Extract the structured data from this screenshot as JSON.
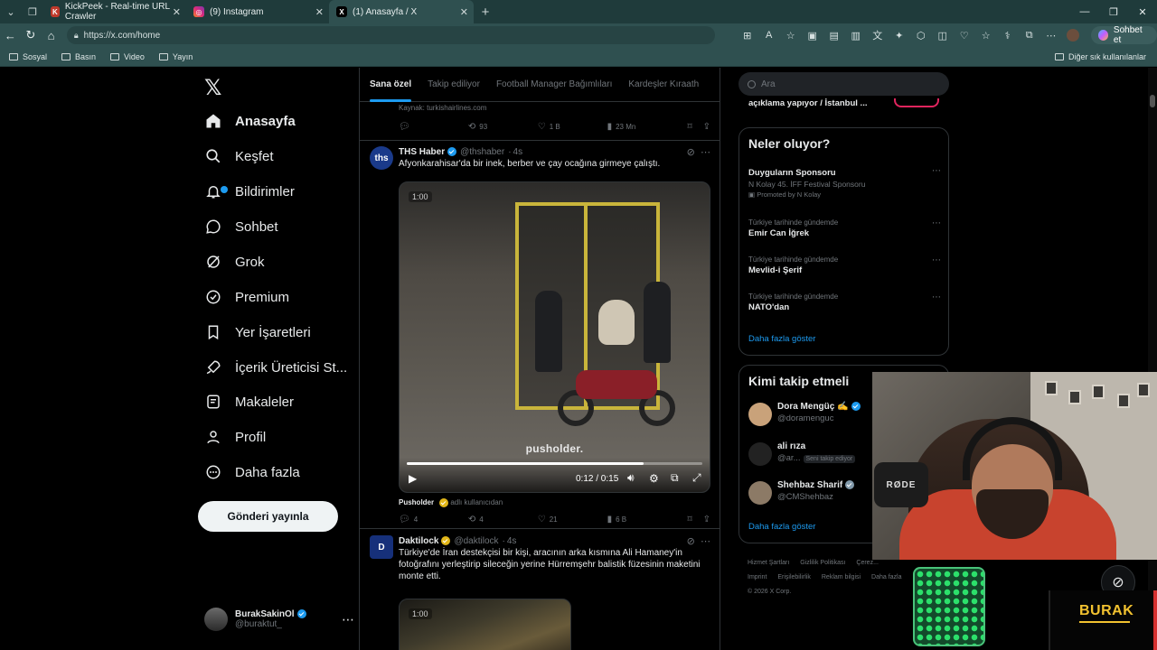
{
  "browser": {
    "tabs": [
      {
        "title": "KickPeek - Real-time URL Crawler",
        "icon": "kickpeek-icon",
        "active": false
      },
      {
        "title": "(9) Instagram",
        "icon": "instagram-icon",
        "active": false
      },
      {
        "title": "(1) Anasayfa / X",
        "icon": "x-icon",
        "active": true
      }
    ],
    "url": "https://x.com/home",
    "copilot_label": "Sohbet et",
    "bookmarks": [
      "Sosyal",
      "Basın",
      "Video",
      "Yayın"
    ],
    "bookmarks_other": "Diğer sık kullanılanlar"
  },
  "nav": {
    "items": [
      {
        "label": "Anasayfa",
        "icon": "home-icon"
      },
      {
        "label": "Keşfet",
        "icon": "search-icon"
      },
      {
        "label": "Bildirimler",
        "icon": "bell-icon"
      },
      {
        "label": "Sohbet",
        "icon": "chat-icon"
      },
      {
        "label": "Grok",
        "icon": "grok-icon"
      },
      {
        "label": "Premium",
        "icon": "premium-icon"
      },
      {
        "label": "Yer İşaretleri",
        "icon": "bookmark-icon"
      },
      {
        "label": "İçerik Üreticisi St...",
        "icon": "rocket-icon"
      },
      {
        "label": "Makaleler",
        "icon": "article-icon"
      },
      {
        "label": "Profil",
        "icon": "profile-icon"
      },
      {
        "label": "Daha fazla",
        "icon": "more-circle-icon"
      }
    ],
    "post_button": "Gönderi yayınla",
    "account": {
      "name": "BurakSakinOl",
      "handle": "@buraktut_"
    }
  },
  "timeline": {
    "tabs": [
      "Sana özel",
      "Takip ediliyor",
      "Football Manager Bağımlıları",
      "Kardeşler Kıraath"
    ],
    "prev_tail": {
      "source": "Kaynak: turkishairlines.com",
      "retweets": "93",
      "likes": "1 B",
      "views": "23 Mn"
    },
    "tweets": [
      {
        "name": "THS Haber",
        "handle": "@thshaber",
        "time": "4s",
        "avatar_text": "ths",
        "text": "Afyonkarahisar'da bir inek, berber ve çay ocağına girmeye çalıştı.",
        "video": {
          "time_chip": "1:00",
          "watermark": "pusholder.",
          "time": "0:12 / 0:15",
          "progress": 0.8
        },
        "attribution_name": "Pusholder",
        "attribution_suffix": "adlı kullanıcıdan",
        "replies": "4",
        "retweets": "4",
        "likes": "21",
        "views": "6 B"
      },
      {
        "name": "Daktilock",
        "handle": "@daktilock",
        "time": "4s",
        "avatar_text": "D",
        "text": "Türkiye'de İran destekçisi bir kişi, aracının arka kısmına Ali Hamaney'in fotoğrafını yerleştirip sileceğin yerine Hürremşehr balistik füzesinin maketini monte etti.",
        "video": {
          "time_chip": "1:00"
        }
      }
    ]
  },
  "right": {
    "search_placeholder": "Ara",
    "live_snippet": "açıklama yapıyor / İstanbul ...",
    "trends_title": "Neler oluyor?",
    "trends": [
      {
        "context": "",
        "title": "Duyguların Sponsoru",
        "sub": "N Kolay 45. İFF Festival Sponsoru",
        "promo": "Promoted by N Kolay"
      },
      {
        "context": "Türkiye tarihinde gündemde",
        "title": "Emir Can İğrek",
        "sub": "",
        "promo": ""
      },
      {
        "context": "Türkiye tarihinde gündemde",
        "title": "Mevlid-i Şerif",
        "sub": "",
        "promo": ""
      },
      {
        "context": "Türkiye tarihinde gündemde",
        "title": "NATO'dan",
        "sub": "",
        "promo": ""
      }
    ],
    "show_more": "Daha fazla göster",
    "who_title": "Kimi takip etmeli",
    "who": [
      {
        "name": "Dora Mengüç ✍️",
        "handle": "@doramenguc",
        "follows_you": ""
      },
      {
        "name": "ali rıza",
        "handle": "@ar...",
        "follows_you": "Seni takip ediyor"
      },
      {
        "name": "Shehbaz Sharif",
        "handle": "@CMShehbaz",
        "follows_you": ""
      }
    ],
    "who_show_more": "Daha fazla göster",
    "footer": [
      "Hizmet Şartları",
      "Gizlilik Politikası",
      "Çerez...",
      "Imprint",
      "Erişilebilirlik",
      "Reklam bilgisi",
      "Daha fazla",
      "© 2026 X Corp."
    ]
  },
  "overlay": {
    "mic_brand": "RØDE",
    "streamer_name": "BURAK"
  },
  "colors": {
    "accent": "#1d9bf0",
    "bg": "#000000",
    "browser_chrome": "#2f5050",
    "brand_yellow": "#f2c230"
  }
}
